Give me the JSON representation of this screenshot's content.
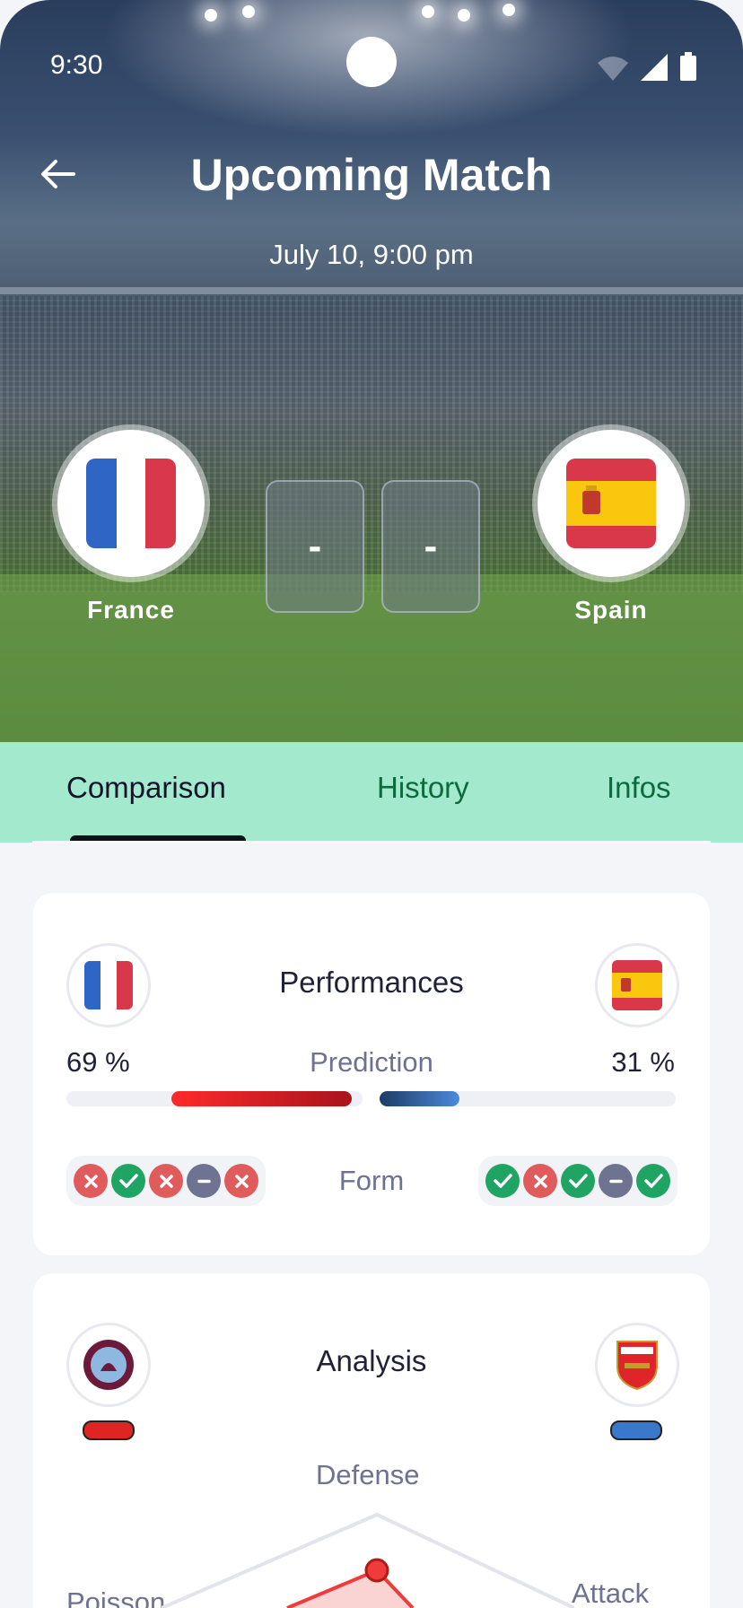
{
  "status_bar": {
    "time": "9:30"
  },
  "header": {
    "title": "Upcoming Match",
    "date": "July 10, 9:00 pm"
  },
  "match": {
    "home": {
      "name": "France"
    },
    "away": {
      "name": "Spain"
    },
    "score_home": "-",
    "score_away": "-"
  },
  "tabs": [
    {
      "label": "Comparison",
      "active": true
    },
    {
      "label": "History",
      "active": false
    },
    {
      "label": "Infos",
      "active": false
    }
  ],
  "performances": {
    "title": "Performances",
    "prediction_label": "Prediction",
    "home_pct": "69 %",
    "away_pct": "31 %",
    "home_pct_value": 69,
    "away_pct_value": 31,
    "form_label": "Form",
    "home_form": [
      "loss",
      "win",
      "loss",
      "draw",
      "loss"
    ],
    "away_form": [
      "win",
      "loss",
      "win",
      "draw",
      "win"
    ]
  },
  "analysis": {
    "title": "Analysis",
    "home_logo": "aston-villa-crest",
    "away_logo": "arsenal-crest",
    "home_color": "#e02424",
    "away_color": "#3a78c9",
    "radar_labels": {
      "top": "Defense",
      "left": "Poisson",
      "right": "Attack"
    }
  },
  "colors": {
    "tab_bg": "#a2e9cd",
    "tab_inactive": "#0d6a3c",
    "win": "#1fa464",
    "loss": "#e05b5b",
    "draw": "#6e7391"
  }
}
